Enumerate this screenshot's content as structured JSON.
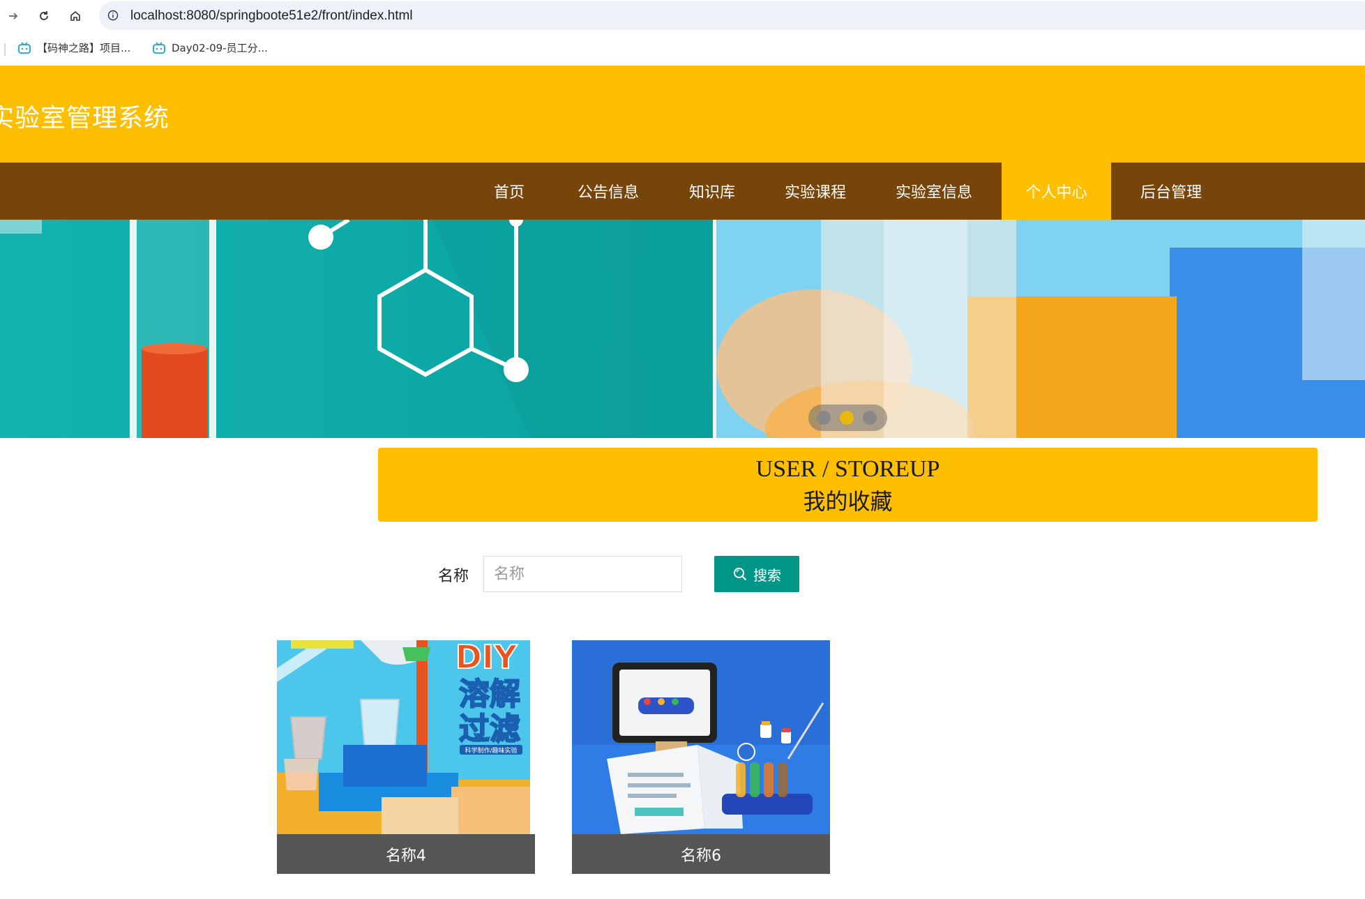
{
  "browser": {
    "url": "localhost:8080/springboote51e2/front/index.html",
    "bookmarks": [
      {
        "label": "【码神之路】项目..."
      },
      {
        "label": "Day02-09-员工分..."
      }
    ]
  },
  "site": {
    "title": "实验室管理系统"
  },
  "nav": {
    "items": [
      {
        "label": "首页"
      },
      {
        "label": "公告信息"
      },
      {
        "label": "知识库"
      },
      {
        "label": "实验课程"
      },
      {
        "label": "实验室信息"
      },
      {
        "label": "个人中心",
        "active": true
      },
      {
        "label": "后台管理"
      }
    ]
  },
  "banner": {
    "dots": [
      {
        "color": "#888888"
      },
      {
        "color": "#e8b80a",
        "active": true
      },
      {
        "color": "#888888"
      }
    ]
  },
  "section": {
    "title_en": "USER / STOREUP",
    "title_cn": "我的收藏"
  },
  "search": {
    "label": "名称",
    "placeholder": "名称",
    "value": "",
    "button_label": "搜索"
  },
  "cards": [
    {
      "caption": "名称4",
      "image_text": {
        "line1": "DIY",
        "line2": "溶解",
        "line3": "过滤",
        "line4": "科学制作/趣味实验"
      }
    },
    {
      "caption": "名称6",
      "image_text": {}
    }
  ],
  "colors": {
    "header": "#fdbf00",
    "nav": "#774509",
    "nav_active": "#fdbf00",
    "search_button": "#009688",
    "card_caption": "#555555"
  }
}
